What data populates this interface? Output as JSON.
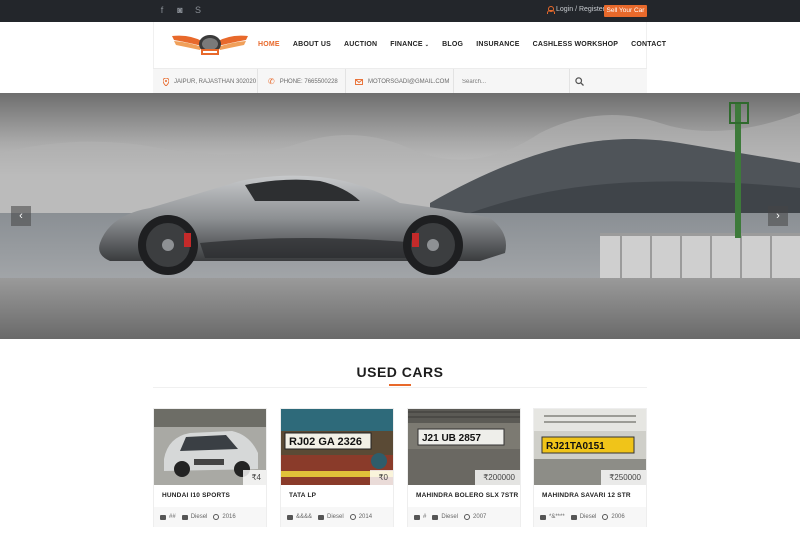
{
  "topbar": {
    "social": [
      {
        "icon": "facebook-icon",
        "glyph": "f"
      },
      {
        "icon": "instagram-icon",
        "glyph": "◙"
      },
      {
        "icon": "skype-icon",
        "glyph": "S"
      }
    ],
    "login_label": "Login / Register",
    "sell_label": "Sell Your Car"
  },
  "nav": {
    "items": [
      {
        "label": "HOME",
        "active": true
      },
      {
        "label": "ABOUT US"
      },
      {
        "label": "AUCTION"
      },
      {
        "label": "FINANCE"
      },
      {
        "label": "BLOG"
      },
      {
        "label": "INSURANCE"
      },
      {
        "label": "CASHLESS WORKSHOP"
      },
      {
        "label": "CONTACT"
      }
    ]
  },
  "info": {
    "location": "JAIPUR, RAJASTHAN 302020",
    "phone": "PHONE: 7665500228",
    "email": "MOTORSGADI@GMAIL.COM",
    "search_placeholder": "Search..."
  },
  "slider": {
    "prev": "‹",
    "next": "›"
  },
  "used_cars": {
    "title": "USED CARS",
    "cards": [
      {
        "name": "HUNDAI I10 SPORTS",
        "price": "₹4",
        "owner": "##",
        "fuel": "Diesel",
        "year": "2016"
      },
      {
        "name": "TATA LP",
        "price": "₹0",
        "owner": "&&&&",
        "fuel": "Diesel",
        "year": "2014"
      },
      {
        "name": "MAHINDRA BOLERO SLX 7STR",
        "price": "₹200000",
        "owner": "#",
        "fuel": "Diesel",
        "year": "2007",
        "plate": "J21 UB 2857"
      },
      {
        "name": "MAHINDRA SAVARI 12 STR",
        "price": "₹250000",
        "owner": "*&****",
        "fuel": "Diesel",
        "year": "2006",
        "plate": "RJ21TA0151"
      }
    ],
    "plates": {
      "card2": "RJ02 GA 2326"
    }
  },
  "colors": {
    "accent": "#e8692b",
    "topbar": "#23262b"
  }
}
